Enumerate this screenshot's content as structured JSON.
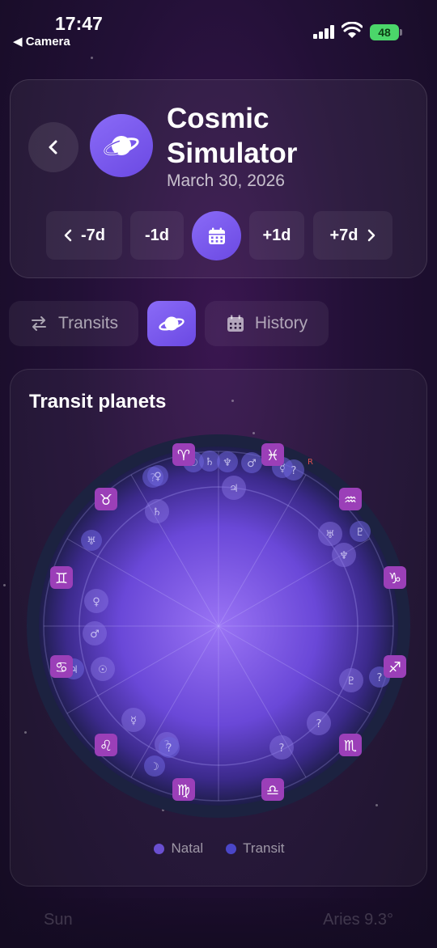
{
  "status_bar": {
    "time": "17:47",
    "back_label": "◀ Camera",
    "battery": "48"
  },
  "header": {
    "title": "Cosmic Simulator",
    "date": "March 30, 2026",
    "nav": {
      "minus7": "-7d",
      "minus1": "-1d",
      "plus1": "+1d",
      "plus7": "+7d"
    }
  },
  "tabs": {
    "transits": "Transits",
    "history": "History"
  },
  "chart": {
    "title": "Transit planets",
    "signs": [
      "♈",
      "♓",
      "♒",
      "♑",
      "♐",
      "♏",
      "♎",
      "♍",
      "♌",
      "♋",
      "♊",
      "♉"
    ],
    "retro_mark": "R",
    "legend": {
      "natal": "Natal",
      "transit": "Transit"
    },
    "colors": {
      "natal": "#6a4fd0",
      "transit": "#4a46c8"
    }
  },
  "faded_row": {
    "planet": "Sun",
    "position": "Aries 9.3°"
  }
}
